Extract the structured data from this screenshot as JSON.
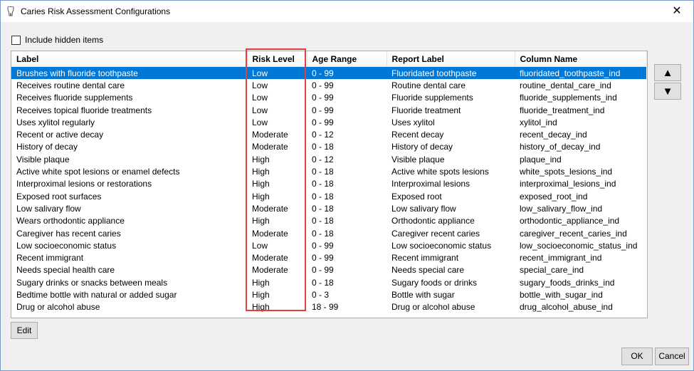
{
  "window": {
    "title": "Caries Risk Assessment Configurations",
    "close_glyph": "✕"
  },
  "include_hidden": {
    "label": "Include hidden items",
    "checked": false
  },
  "table": {
    "columns": [
      "Label",
      "Risk Level",
      "Age Range",
      "Report Label",
      "Column Name"
    ],
    "selected_row": 0,
    "rows": [
      [
        "Brushes with fluoride toothpaste",
        "Low",
        "0 - 99",
        "Fluoridated toothpaste",
        "fluoridated_toothpaste_ind"
      ],
      [
        "Receives routine dental care",
        "Low",
        "0 - 99",
        "Routine dental care",
        "routine_dental_care_ind"
      ],
      [
        "Receives fluoride supplements",
        "Low",
        "0 - 99",
        "Fluoride supplements",
        "fluoride_supplements_ind"
      ],
      [
        "Receives topical fluoride treatments",
        "Low",
        "0 - 99",
        "Fluoride treatment",
        "fluoride_treatment_ind"
      ],
      [
        "Uses xylitol regularly",
        "Low",
        "0 - 99",
        "Uses xylitol",
        "xylitol_ind"
      ],
      [
        "Recent or active decay",
        "Moderate",
        "0 - 12",
        "Recent decay",
        "recent_decay_ind"
      ],
      [
        "History of decay",
        "Moderate",
        "0 - 18",
        "History of decay",
        "history_of_decay_ind"
      ],
      [
        "Visible plaque",
        "High",
        "0 - 12",
        "Visible plaque",
        "plaque_ind"
      ],
      [
        "Active white spot lesions or enamel defects",
        "High",
        "0 - 18",
        "Active white spots lesions",
        "white_spots_lesions_ind"
      ],
      [
        "Interproximal lesions or restorations",
        "High",
        "0 - 18",
        "Interproximal lesions",
        "interproximal_lesions_ind"
      ],
      [
        "Exposed root surfaces",
        "High",
        "0 - 18",
        "Exposed root",
        "exposed_root_ind"
      ],
      [
        "Low salivary flow",
        "Moderate",
        "0 - 18",
        "Low salivary flow",
        "low_salivary_flow_ind"
      ],
      [
        "Wears orthodontic appliance",
        "High",
        "0 - 18",
        "Orthodontic appliance",
        "orthodontic_appliance_ind"
      ],
      [
        "Caregiver has recent caries",
        "Moderate",
        "0 - 18",
        "Caregiver recent caries",
        "caregiver_recent_caries_ind"
      ],
      [
        "Low socioeconomic status",
        "Low",
        "0 - 99",
        "Low socioeconomic status",
        "low_socioeconomic_status_ind"
      ],
      [
        "Recent immigrant",
        "Moderate",
        "0 - 99",
        "Recent immigrant",
        "recent_immigrant_ind"
      ],
      [
        "Needs special health care",
        "Moderate",
        "0 - 99",
        "Needs special care",
        "special_care_ind"
      ],
      [
        "Sugary drinks or snacks between meals",
        "High",
        "0 - 18",
        "Sugary foods or drinks",
        "sugary_foods_drinks_ind"
      ],
      [
        "Bedtime bottle with natural or added sugar",
        "High",
        "0 - 3",
        "Bottle with sugar",
        "bottle_with_sugar_ind"
      ],
      [
        "Drug or alcohol abuse",
        "High",
        "18 - 99",
        "Drug or alcohol abuse",
        "drug_alcohol_abuse_ind"
      ]
    ]
  },
  "buttons": {
    "move_up": "▲",
    "move_down": "▼",
    "edit": "Edit",
    "ok": "OK",
    "cancel": "Cancel"
  },
  "colors": {
    "selection": "#0078d7",
    "highlight_box": "#e04040"
  }
}
